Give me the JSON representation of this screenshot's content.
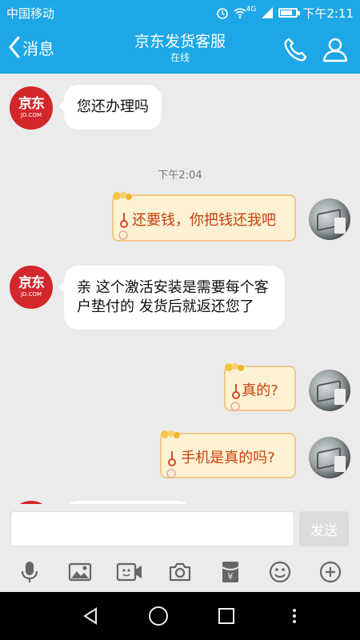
{
  "status": {
    "carrier": "中国移动",
    "network": "4G",
    "time": "下午2:11"
  },
  "header": {
    "back_label": "消息",
    "title": "京东发货客服",
    "subtitle": "在线"
  },
  "jd_avatar": {
    "logo_text": "京东",
    "logo_sub": "JD.COM"
  },
  "messages": [
    {
      "sender": "agent",
      "text": "您还办理吗"
    },
    {
      "sender": "user",
      "text": "还要钱，你把钱还我吧"
    },
    {
      "sender": "agent",
      "text": "亲  这个激活安装是需要每个客户垫付的  发货后就返还您了"
    },
    {
      "sender": "user",
      "text": "真的?"
    },
    {
      "sender": "user",
      "text": "手机是真的吗?"
    }
  ],
  "timestamp": "下午2:04",
  "composer": {
    "input_value": "",
    "send_label": "发送"
  },
  "toolbar": [
    "mic-icon",
    "image-icon",
    "video-icon",
    "camera-icon",
    "red-packet-icon",
    "emoji-icon",
    "plus-icon"
  ],
  "colors": {
    "accent": "#1ea7e6",
    "jd_red": "#d3272b",
    "user_text": "#c9410d",
    "user_bubble": "#fdf1d4"
  }
}
